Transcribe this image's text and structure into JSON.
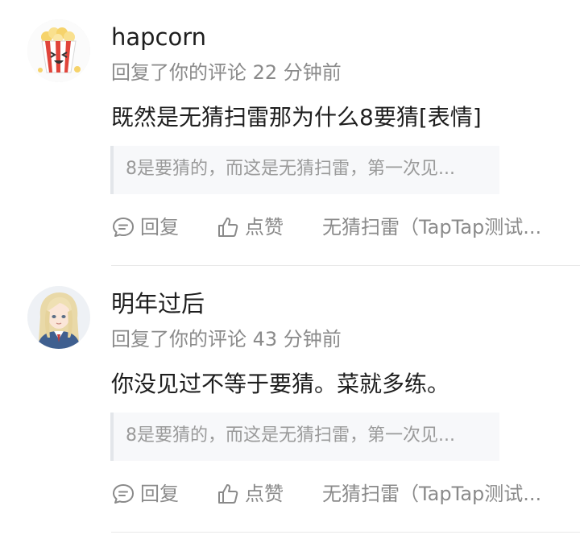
{
  "notifications": [
    {
      "user_name": "hapcorn",
      "avatar_icon": "popcorn-avatar-icon",
      "meta": "回复了你的评论 22 分钟前",
      "content": "既然是无猜扫雷那为什么8要猜[表情]",
      "quote": "8是要猜的，而这是无猜扫雷，第一次见...",
      "reply_label": "回复",
      "like_label": "点赞",
      "source": "无猜扫雷（TapTap测试..."
    },
    {
      "user_name": "明年过后",
      "avatar_icon": "anime-girl-avatar-icon",
      "meta": "回复了你的评论 43 分钟前",
      "content": "你没见过不等于要猜。菜就多练。",
      "quote": "8是要猜的，而这是无猜扫雷，第一次见...",
      "reply_label": "回复",
      "like_label": "点赞",
      "source": "无猜扫雷（TapTap测试..."
    }
  ],
  "colors": {
    "primary_text": "#1e1e1e",
    "secondary_text": "#8a8a8a",
    "quote_bg": "#f7f8fa",
    "quote_border": "#e3e6ea"
  }
}
